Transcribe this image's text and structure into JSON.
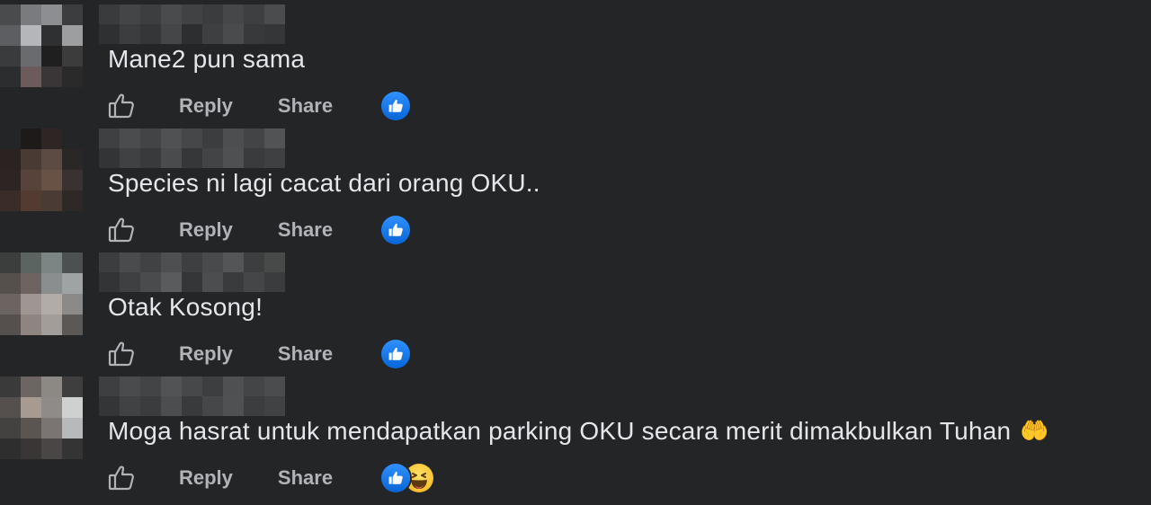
{
  "actions": {
    "reply_label": "Reply",
    "share_label": "Share"
  },
  "comments": [
    {
      "text": "Mane2 pun sama",
      "reactions": [
        "like"
      ],
      "avatar_colors": [
        "#4a4b4d",
        "#7a7b7e",
        "#8c8e91",
        "#3c3d3f",
        "#5d5e62",
        "#b4b6ba",
        "#2f3031",
        "#9c9ea0",
        "#3a3b3d",
        "#6a6b6e",
        "#1f1f20",
        "#3c3c3d",
        "#2c2d2e",
        "#6e5b5c",
        "#3a3536",
        "#2a2a2b"
      ],
      "name_blur_colors": [
        [
          "#3a3b3c",
          "#444546",
          "#3d3e3f",
          "#4a4b4c",
          "#414243",
          "#3b3c3d",
          "#464748",
          "#3e3f40",
          "#4b4c4d"
        ],
        [
          "#2f3031",
          "#3c3d3e",
          "#353637",
          "#454647",
          "#2d2e2f",
          "#3e3f40",
          "#4a4b4c",
          "#38393a",
          "#353637"
        ]
      ]
    },
    {
      "text": "Species ni lagi cacat dari orang OKU..",
      "reactions": [
        "like"
      ],
      "avatar_colors": [
        "#242526",
        "#1e1a19",
        "#2e2624",
        "#242526",
        "#2b2321",
        "#4a3a33",
        "#5e4b41",
        "#2c2727",
        "#2d2523",
        "#5a4338",
        "#6a5243",
        "#3a3230",
        "#3a2c28",
        "#553b31",
        "#4c3b34",
        "#2f2826"
      ],
      "name_blur_colors": [
        [
          "#3f4041",
          "#4b4c4d",
          "#434445",
          "#505152",
          "#464748",
          "#3c3d3e",
          "#4d4e4f",
          "#434445",
          "#525354"
        ],
        [
          "#333435",
          "#404142",
          "#393a3b",
          "#4a4b4c",
          "#363738",
          "#434445",
          "#4f5051",
          "#3a3b3c",
          "#3f4041"
        ]
      ]
    },
    {
      "text": "Otak Kosong!",
      "reactions": [
        "like"
      ],
      "avatar_colors": [
        "#3c3e3e",
        "#5b6462",
        "#798584",
        "#4a5150",
        "#57504c",
        "#6e6462",
        "#8a8e8e",
        "#9ea4a4",
        "#6c6461",
        "#a09590",
        "#b2aca8",
        "#8c8a88",
        "#55504d",
        "#8f857f",
        "#a39d99",
        "#5b5856"
      ],
      "name_blur_colors": [
        [
          "#3c3d3e",
          "#4a4b4c",
          "#414243",
          "#4e4f50",
          "#3e3f40",
          "#494a4b",
          "#545556",
          "#3d3e3f",
          "#484949"
        ],
        [
          "#333435",
          "#3f4041",
          "#4a4b4c",
          "#5a5b5c",
          "#353637",
          "#4c4d4e",
          "#3a3b3c",
          "#454647",
          "#3b3c3d"
        ]
      ]
    },
    {
      "text": "Moga hasrat untuk mendapatkan parking OKU secara merit dimakbulkan Tuhan",
      "emoji": "🤲",
      "reactions": [
        "like",
        "haha"
      ],
      "avatar_colors": [
        "#3a3a3b",
        "#6d6560",
        "#8c8985",
        "#3e3e3f",
        "#55504e",
        "#a89a90",
        "#8f8b88",
        "#cfd0d0",
        "#444141",
        "#5c5550",
        "#7a7472",
        "#b8b9ba",
        "#2f2e2e",
        "#3a3635",
        "#4a4646",
        "#353434"
      ],
      "name_blur_colors": [
        [
          "#3e3f40",
          "#4a4b4c",
          "#434445",
          "#525354",
          "#474849",
          "#3d3e3f",
          "#4f5051",
          "#444546",
          "#4b4c4d"
        ],
        [
          "#343536",
          "#414243",
          "#3b3c3d",
          "#4c4d4e",
          "#393a3b",
          "#464748",
          "#505152",
          "#3c3d3e",
          "#414243"
        ]
      ]
    }
  ]
}
